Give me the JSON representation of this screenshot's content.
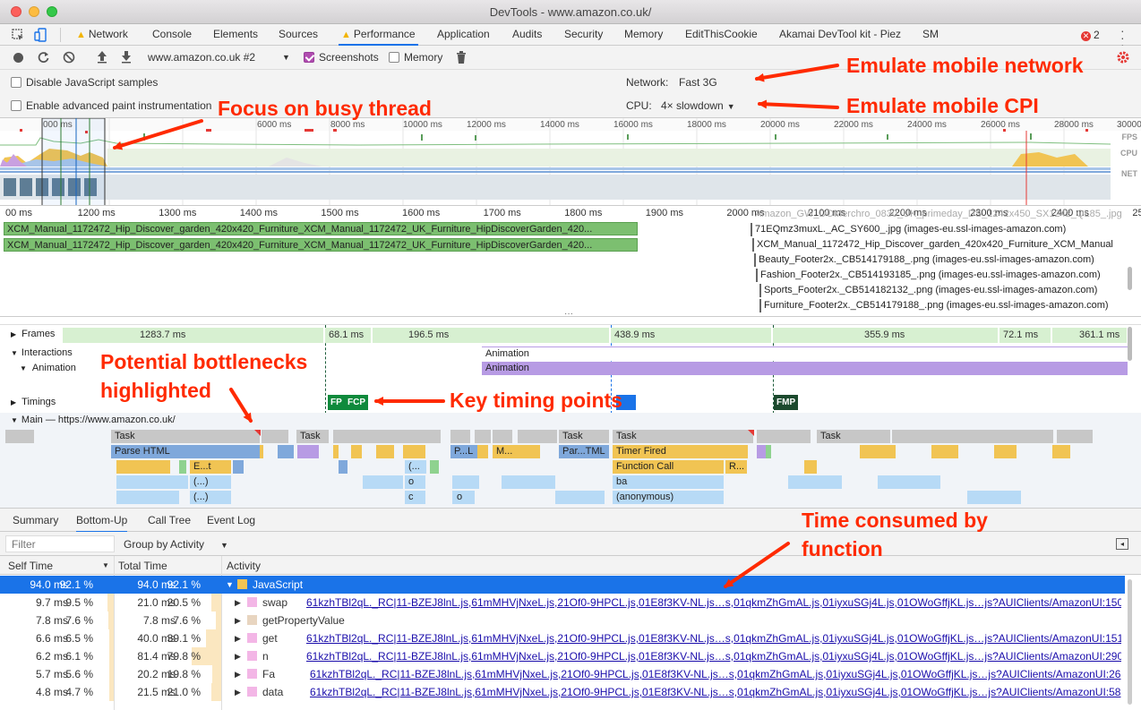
{
  "window": {
    "title": "DevTools - www.amazon.co.uk/"
  },
  "tabs": [
    "Network",
    "Console",
    "Elements",
    "Sources",
    "Performance",
    "Application",
    "Audits",
    "Security",
    "Memory",
    "EditThisCookie",
    "Akamai DevTool kit - Piez",
    "SM"
  ],
  "error_count": "2",
  "toolbar": {
    "profile": "www.amazon.co.uk #2",
    "screenshots_label": "Screenshots",
    "memory_label": "Memory"
  },
  "settings": {
    "disable_js_samples": "Disable JavaScript samples",
    "advanced_paint": "Enable advanced paint instrumentation",
    "network_label": "Network:",
    "network_value": "Fast 3G",
    "cpu_label": "CPU:",
    "cpu_value": "4× slowdown"
  },
  "overview": {
    "ticks": [
      "000 ms",
      "6000 ms",
      "8000 ms",
      "10000 ms",
      "12000 ms",
      "14000 ms",
      "16000 ms",
      "18000 ms",
      "20000 ms",
      "22000 ms",
      "24000 ms",
      "26000 ms",
      "28000 ms",
      "30000 ms",
      "32000"
    ],
    "side": [
      "FPS",
      "CPU",
      "NET"
    ]
  },
  "detail_ruler": [
    "00 ms",
    "1200 ms",
    "1300 ms",
    "1400 ms",
    "1500 ms",
    "1600 ms",
    "1700 ms",
    "1800 ms",
    "1900 ms",
    "2000 ms",
    "2100 ms",
    "2200 ms",
    "2300 ms",
    "2400 ms",
    "2500 ms",
    "2600 ms",
    "2700 ms",
    "2800 ms"
  ],
  "network_rows": [
    "XCM_Manual_1172472_Hip_Discover_garden_420x420_Furniture_XCM_Manual_1172472_UK_Furniture_HipDiscoverGarden_420...",
    "XCM_Manual_1172472_Hip_Discover_garden_420x420_Furniture_XCM_Manual_1172472_UK_Furniture_HipDiscoverGarden_420...",
    "Amazon_GW_DOMerchro_0830_UK_primeday_DS_1242x450_SX1242_QL85_.jpg",
    "71EQmz3muxL._AC_SY600_.jpg (images-eu.ssl-images-amazon.com)",
    "XCM_Manual_1172472_Hip_Discover_garden_420x420_Furniture_XCM_Manual",
    "Beauty_Footer2x._CB514179188_.png (images-eu.ssl-images-amazon.com)",
    "Fashion_Footer2x._CB514193185_.png (images-eu.ssl-images-amazon.com)",
    "Sports_Footer2x._CB514182132_.png (images-eu.ssl-images-amazon.com)",
    "Furniture_Footer2x._CB514179188_.png (images-eu.ssl-images-amazon.com)"
  ],
  "tracks": {
    "frames_label": "Frames",
    "frames": [
      "1283.7 ms",
      "68.1 ms",
      "196.5 ms",
      "438.9 ms",
      "355.9 ms",
      "72.1 ms",
      "361.1 ms"
    ],
    "interactions_label": "Interactions",
    "animation_label": "Animation",
    "animation_bar_1": "Animation",
    "animation_bar_2": "Animation",
    "timings_label": "Timings",
    "markers": [
      "FP",
      "FCP",
      "FMP"
    ],
    "main_label": "Main — https://www.amazon.co.uk/",
    "task_label": "Task",
    "parse_html": "Parse HTML",
    "timer_fired": "Timer Fired",
    "function_call": "Function Call",
    "ba": "ba",
    "anonymous": "(anonymous)",
    "short_labels": [
      "E...t",
      "(...)",
      "(...)",
      "(...",
      "o",
      "c",
      "o",
      "P...L",
      "M...",
      "Par...TML",
      "R..."
    ]
  },
  "bottom_tabs": [
    "Summary",
    "Bottom-Up",
    "Call Tree",
    "Event Log"
  ],
  "filter": {
    "placeholder": "Filter",
    "group": "Group by Activity"
  },
  "table": {
    "headers": [
      "Self Time",
      "Total Time",
      "Activity"
    ],
    "rows": [
      {
        "self": "94.0 ms",
        "self_pct": "92.1 %",
        "total": "94.0 ms",
        "total_pct": "92.1 %",
        "activity": "JavaScript",
        "url": "",
        "color": "#f1c453"
      },
      {
        "self": "9.7 ms",
        "self_pct": "9.5 %",
        "total": "21.0 ms",
        "total_pct": "20.5 %",
        "activity": "swap",
        "url": "61kzhTBl2qL._RC|11-BZEJ8lnL.js,61mMHVjNxeL.js,21Of0-9HPCL.js,01E8f3KV-NL.js…s,01qkmZhGmAL.js,01iyxuSGj4L.js,01OWoGffjKL.js…js?AUIClients/AmazonUI:150",
        "color": "#f3b6e6"
      },
      {
        "self": "7.8 ms",
        "self_pct": "7.6 %",
        "total": "7.8 ms",
        "total_pct": "7.6 %",
        "activity": "getPropertyValue",
        "url": "",
        "color": "#e8d5c0"
      },
      {
        "self": "6.6 ms",
        "self_pct": "6.5 %",
        "total": "40.0 ms",
        "total_pct": "39.1 %",
        "activity": "get",
        "url": "61kzhTBl2qL._RC|11-BZEJ8lnL.js,61mMHVjNxeL.js,21Of0-9HPCL.js,01E8f3KV-NL.js…s,01qkmZhGmAL.js,01iyxuSGj4L.js,01OWoGffjKL.js…js?AUIClients/AmazonUI:151",
        "color": "#f3b6e6"
      },
      {
        "self": "6.2 ms",
        "self_pct": "6.1 %",
        "total": "81.4 ms",
        "total_pct": "79.8 %",
        "activity": "n",
        "url": "61kzhTBl2qL._RC|11-BZEJ8lnL.js,61mMHVjNxeL.js,21Of0-9HPCL.js,01E8f3KV-NL.js…s,01qkmZhGmAL.js,01iyxuSGj4L.js,01OWoGffjKL.js…js?AUIClients/AmazonUI:290",
        "color": "#f3b6e6"
      },
      {
        "self": "5.7 ms",
        "self_pct": "5.6 %",
        "total": "20.2 ms",
        "total_pct": "19.8 %",
        "activity": "Fa",
        "url": "61kzhTBl2qL._RC|11-BZEJ8lnL.js,61mMHVjNxeL.js,21Of0-9HPCL.js,01E8f3KV-NL.js…s,01qkmZhGmAL.js,01iyxuSGj4L.js,01OWoGffjKL.js…js?AUIClients/AmazonUI:26",
        "color": "#f3b6e6"
      },
      {
        "self": "4.8 ms",
        "self_pct": "4.7 %",
        "total": "21.5 ms",
        "total_pct": "21.0 %",
        "activity": "data",
        "url": "61kzhTBl2qL._RC|11-BZEJ8lnL.js,61mMHVjNxeL.js,21Of0-9HPCL.js,01E8f3KV-NL.js…s,01qkmZhGmAL.js,01iyxuSGj4L.js,01OWoGffjKL.js…js?AUIClients/AmazonUI:58",
        "color": "#f3b6e6"
      }
    ]
  },
  "callouts": {
    "network": "Emulate mobile network",
    "cpu": "Emulate mobile CPI",
    "thread": "Focus on busy thread",
    "bottlenecks_1": "Potential bottlenecks",
    "bottlenecks_2": "highlighted",
    "timing": "Key timing points",
    "time_1": "Time consumed by",
    "time_2": "function"
  },
  "colors": {
    "accent": "#1a73e8",
    "callout": "#ff2a00"
  }
}
